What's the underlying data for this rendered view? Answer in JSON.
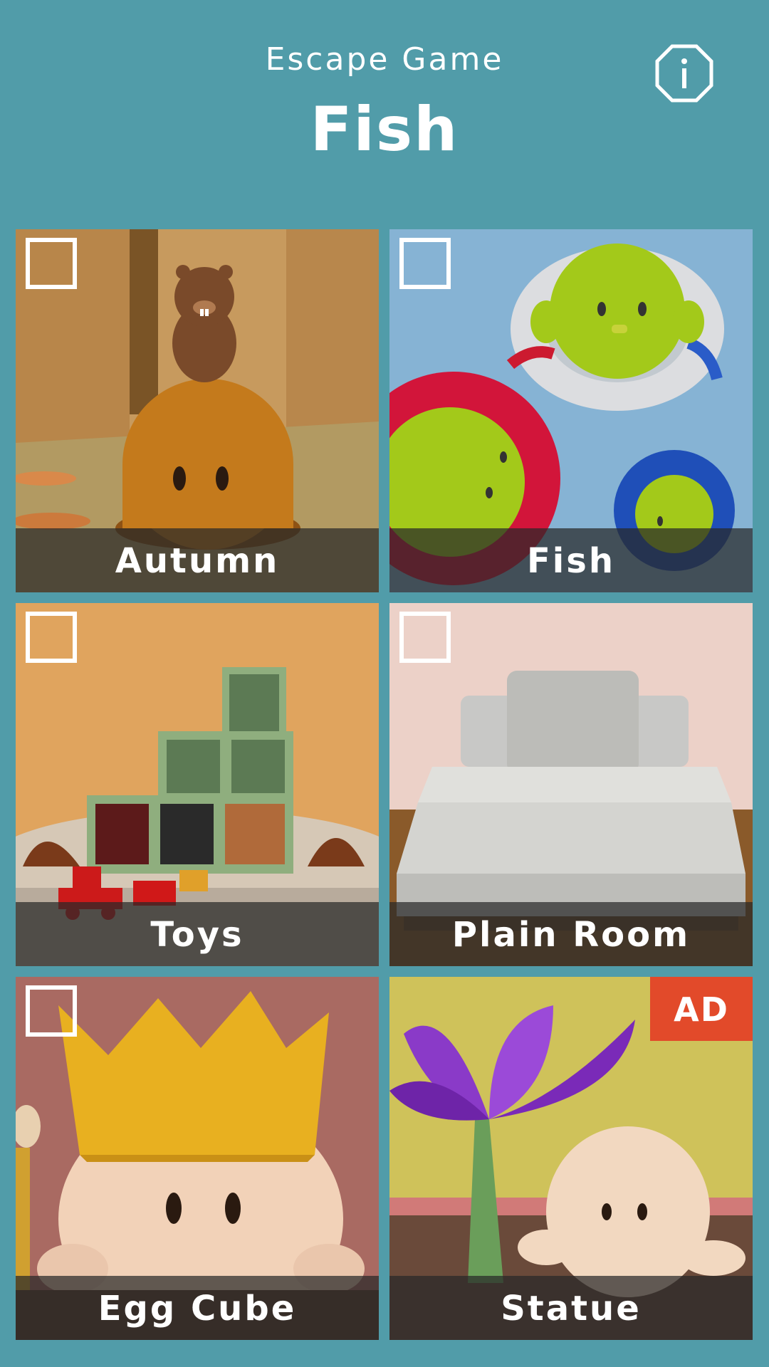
{
  "header": {
    "subtitle": "Escape Game",
    "title": "Fish",
    "info_icon": "info-icon"
  },
  "colors": {
    "background": "#519ca9",
    "ad_badge": "#e24a2a"
  },
  "levels": [
    {
      "label": "Autumn",
      "ad": false,
      "completed": false
    },
    {
      "label": "Fish",
      "ad": false,
      "completed": false
    },
    {
      "label": "Toys",
      "ad": false,
      "completed": false
    },
    {
      "label": "Plain Room",
      "ad": false,
      "completed": false
    },
    {
      "label": "Egg Cube",
      "ad": false,
      "completed": false
    },
    {
      "label": "Statue",
      "ad": true,
      "ad_label": "AD",
      "completed": false
    }
  ]
}
